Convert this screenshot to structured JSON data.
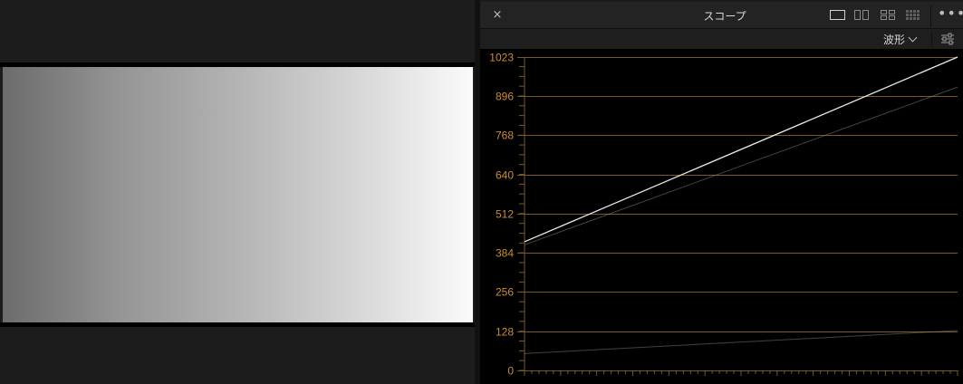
{
  "panel": {
    "title": "スコープ",
    "close_glyph": "×",
    "more_glyph": "•••",
    "mode_label": "波形",
    "layout_options": [
      "single",
      "dual",
      "quad",
      "octo"
    ],
    "icons": [
      "close-icon",
      "single-view-icon",
      "dual-view-icon",
      "quad-view-icon",
      "octo-view-icon",
      "more-icon",
      "chevron-down-icon",
      "settings-sliders-icon"
    ]
  },
  "colors": {
    "grid": "#7a5a20",
    "tick_label": "#c98f2f",
    "trace": "#e6e6e6"
  },
  "chart_data": {
    "type": "line",
    "title": "",
    "xlabel": "",
    "ylabel": "",
    "ylim": [
      0,
      1023
    ],
    "xlim": [
      0,
      100
    ],
    "yticks": [
      0,
      128,
      256,
      384,
      512,
      640,
      768,
      896,
      1023
    ],
    "ytick_labels": [
      "0",
      "128",
      "256",
      "384",
      "512",
      "640",
      "768",
      "896",
      "1023"
    ],
    "minor_y_step": 32,
    "minor_x_count": 60,
    "grid": true,
    "series": [
      {
        "x": [
          0,
          100
        ],
        "values": [
          420,
          1023
        ],
        "color": "#e8e8e8",
        "width": 1.3,
        "opacity": 1
      },
      {
        "x": [
          0,
          100
        ],
        "values": [
          410,
          925
        ],
        "color": "#9a9a9a",
        "width": 1,
        "opacity": 0.45
      },
      {
        "x": [
          0,
          100
        ],
        "values": [
          55,
          130
        ],
        "color": "#bcbcbc",
        "width": 1,
        "opacity": 0.35
      }
    ]
  }
}
